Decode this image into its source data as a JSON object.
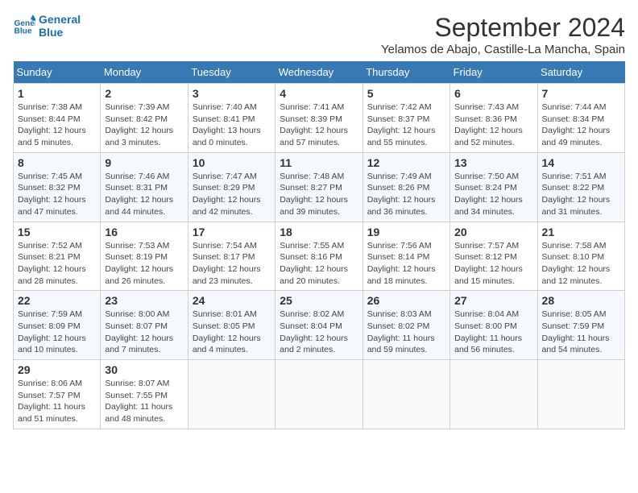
{
  "header": {
    "logo_line1": "General",
    "logo_line2": "Blue",
    "month_title": "September 2024",
    "location": "Yelamos de Abajo, Castille-La Mancha, Spain"
  },
  "weekdays": [
    "Sunday",
    "Monday",
    "Tuesday",
    "Wednesday",
    "Thursday",
    "Friday",
    "Saturday"
  ],
  "weeks": [
    [
      {
        "day": "1",
        "sunrise": "7:38 AM",
        "sunset": "8:44 PM",
        "daylight": "12 hours and 5 minutes"
      },
      {
        "day": "2",
        "sunrise": "7:39 AM",
        "sunset": "8:42 PM",
        "daylight": "12 hours and 3 minutes"
      },
      {
        "day": "3",
        "sunrise": "7:40 AM",
        "sunset": "8:41 PM",
        "daylight": "13 hours and 0 minutes"
      },
      {
        "day": "4",
        "sunrise": "7:41 AM",
        "sunset": "8:39 PM",
        "daylight": "12 hours and 57 minutes"
      },
      {
        "day": "5",
        "sunrise": "7:42 AM",
        "sunset": "8:37 PM",
        "daylight": "12 hours and 55 minutes"
      },
      {
        "day": "6",
        "sunrise": "7:43 AM",
        "sunset": "8:36 PM",
        "daylight": "12 hours and 52 minutes"
      },
      {
        "day": "7",
        "sunrise": "7:44 AM",
        "sunset": "8:34 PM",
        "daylight": "12 hours and 49 minutes"
      }
    ],
    [
      {
        "day": "8",
        "sunrise": "7:45 AM",
        "sunset": "8:32 PM",
        "daylight": "12 hours and 47 minutes"
      },
      {
        "day": "9",
        "sunrise": "7:46 AM",
        "sunset": "8:31 PM",
        "daylight": "12 hours and 44 minutes"
      },
      {
        "day": "10",
        "sunrise": "7:47 AM",
        "sunset": "8:29 PM",
        "daylight": "12 hours and 42 minutes"
      },
      {
        "day": "11",
        "sunrise": "7:48 AM",
        "sunset": "8:27 PM",
        "daylight": "12 hours and 39 minutes"
      },
      {
        "day": "12",
        "sunrise": "7:49 AM",
        "sunset": "8:26 PM",
        "daylight": "12 hours and 36 minutes"
      },
      {
        "day": "13",
        "sunrise": "7:50 AM",
        "sunset": "8:24 PM",
        "daylight": "12 hours and 34 minutes"
      },
      {
        "day": "14",
        "sunrise": "7:51 AM",
        "sunset": "8:22 PM",
        "daylight": "12 hours and 31 minutes"
      }
    ],
    [
      {
        "day": "15",
        "sunrise": "7:52 AM",
        "sunset": "8:21 PM",
        "daylight": "12 hours and 28 minutes"
      },
      {
        "day": "16",
        "sunrise": "7:53 AM",
        "sunset": "8:19 PM",
        "daylight": "12 hours and 26 minutes"
      },
      {
        "day": "17",
        "sunrise": "7:54 AM",
        "sunset": "8:17 PM",
        "daylight": "12 hours and 23 minutes"
      },
      {
        "day": "18",
        "sunrise": "7:55 AM",
        "sunset": "8:16 PM",
        "daylight": "12 hours and 20 minutes"
      },
      {
        "day": "19",
        "sunrise": "7:56 AM",
        "sunset": "8:14 PM",
        "daylight": "12 hours and 18 minutes"
      },
      {
        "day": "20",
        "sunrise": "7:57 AM",
        "sunset": "8:12 PM",
        "daylight": "12 hours and 15 minutes"
      },
      {
        "day": "21",
        "sunrise": "7:58 AM",
        "sunset": "8:10 PM",
        "daylight": "12 hours and 12 minutes"
      }
    ],
    [
      {
        "day": "22",
        "sunrise": "7:59 AM",
        "sunset": "8:09 PM",
        "daylight": "12 hours and 10 minutes"
      },
      {
        "day": "23",
        "sunrise": "8:00 AM",
        "sunset": "8:07 PM",
        "daylight": "12 hours and 7 minutes"
      },
      {
        "day": "24",
        "sunrise": "8:01 AM",
        "sunset": "8:05 PM",
        "daylight": "12 hours and 4 minutes"
      },
      {
        "day": "25",
        "sunrise": "8:02 AM",
        "sunset": "8:04 PM",
        "daylight": "12 hours and 2 minutes"
      },
      {
        "day": "26",
        "sunrise": "8:03 AM",
        "sunset": "8:02 PM",
        "daylight": "11 hours and 59 minutes"
      },
      {
        "day": "27",
        "sunrise": "8:04 AM",
        "sunset": "8:00 PM",
        "daylight": "11 hours and 56 minutes"
      },
      {
        "day": "28",
        "sunrise": "8:05 AM",
        "sunset": "7:59 PM",
        "daylight": "11 hours and 54 minutes"
      }
    ],
    [
      {
        "day": "29",
        "sunrise": "8:06 AM",
        "sunset": "7:57 PM",
        "daylight": "11 hours and 51 minutes"
      },
      {
        "day": "30",
        "sunrise": "8:07 AM",
        "sunset": "7:55 PM",
        "daylight": "11 hours and 48 minutes"
      },
      null,
      null,
      null,
      null,
      null
    ]
  ]
}
